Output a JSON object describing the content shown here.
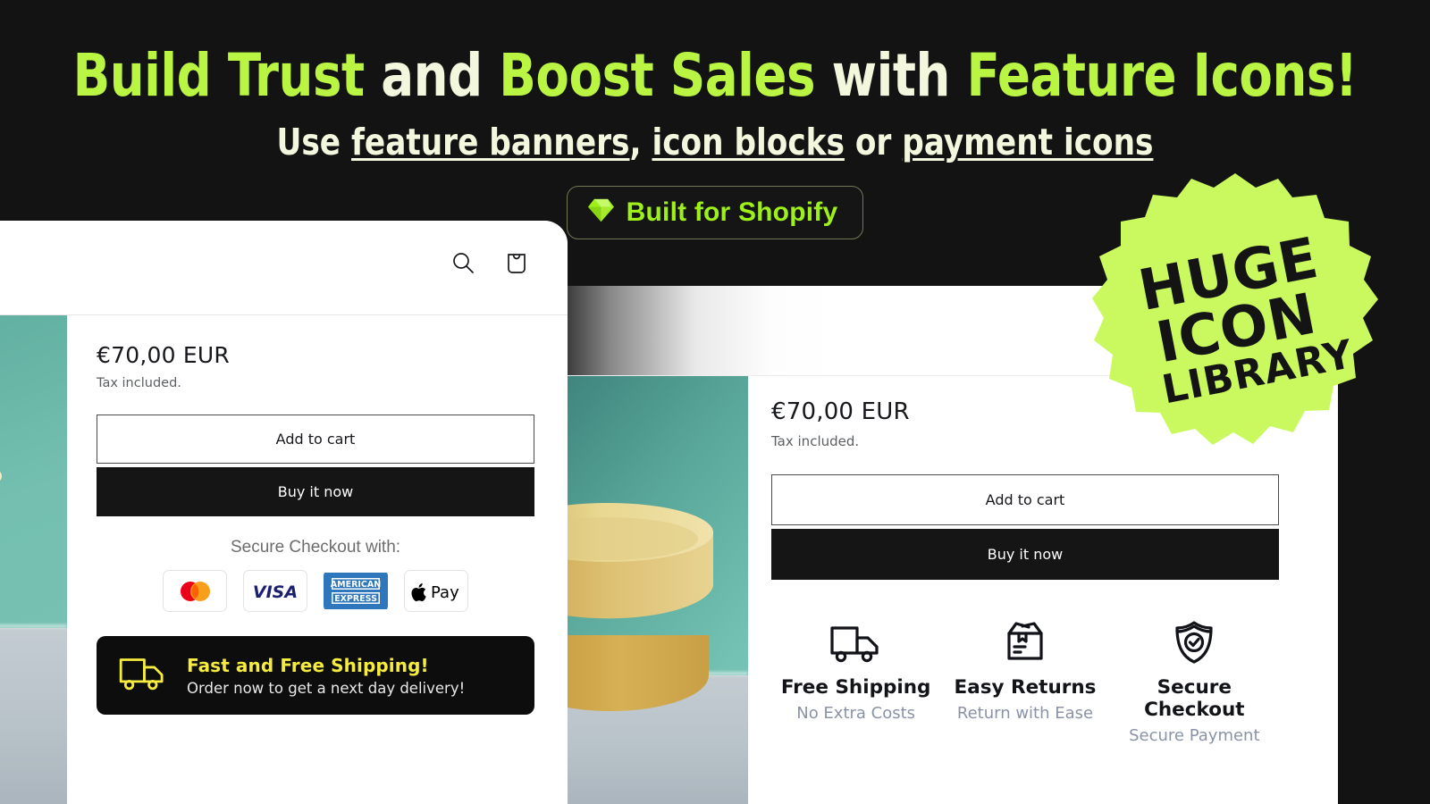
{
  "hero": {
    "headline_parts": [
      {
        "text": "Build Trust ",
        "style": "green"
      },
      {
        "text": "and ",
        "style": "cream"
      },
      {
        "text": "Boost Sales ",
        "style": "green"
      },
      {
        "text": "with ",
        "style": "cream"
      },
      {
        "text": "Feature Icons!",
        "style": "green"
      }
    ],
    "headline_1": "Build Trust ",
    "headline_2": "and ",
    "headline_3": "Boost Sales ",
    "headline_4": "with ",
    "headline_5": "Feature Icons!",
    "sub_1": "Use ",
    "sub_2": "feature banners",
    "sub_3": ", ",
    "sub_4": "icon blocks",
    "sub_5": " or ",
    "sub_6": "payment icons",
    "badge_label": "Built for Shopify",
    "badge_icon": "gem-icon",
    "color_green": "#b9f542",
    "color_cream": "#f2f7dd",
    "color_badge_green": "#9ef01a"
  },
  "sticker": {
    "line1": "HUGE",
    "line2": "ICON",
    "line3": "LIBRARY",
    "color": "#caf95f",
    "text_color": "#141414"
  },
  "left_card": {
    "header_icons": [
      {
        "name": "search-icon",
        "label": "Search"
      },
      {
        "name": "cart-icon",
        "label": "Cart"
      }
    ],
    "price": "€70,00 EUR",
    "tax_note": "Tax included.",
    "add_to_cart_label": "Add to cart",
    "buy_now_label": "Buy it now",
    "secure_label": "Secure Checkout with:",
    "payment_icons": [
      {
        "name": "mastercard-icon",
        "label": "Mastercard"
      },
      {
        "name": "visa-icon",
        "label": "VISA"
      },
      {
        "name": "amex-icon",
        "label": "AMERICAN EXPRESS"
      },
      {
        "name": "apple-pay-icon",
        "label": "Apple Pay"
      }
    ],
    "shipping_banner": {
      "icon": "truck-icon",
      "title": "Fast and Free Shipping!",
      "subtitle": "Order now to get a next day delivery!",
      "title_color": "#f5ec3d",
      "background": "#0d0d0d"
    }
  },
  "right_card": {
    "price": "€70,00 EUR",
    "tax_note": "Tax included.",
    "add_to_cart_label": "Add to cart",
    "buy_now_label": "Buy it now",
    "features": [
      {
        "icon": "truck-icon",
        "title": "Free Shipping",
        "subtitle": "No Extra Costs"
      },
      {
        "icon": "open-box-icon",
        "title": "Easy Returns",
        "subtitle": "Return with Ease"
      },
      {
        "icon": "shield-check-icon",
        "title": "Secure Checkout",
        "subtitle": "Secure Payment"
      }
    ],
    "subtitle_color": "#8a93a6"
  }
}
